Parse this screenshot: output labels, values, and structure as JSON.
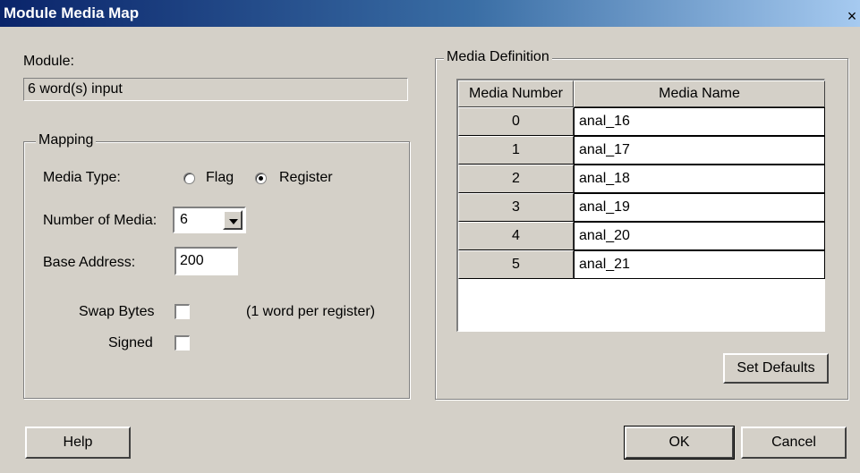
{
  "window": {
    "title": "Module Media Map",
    "close_glyph": "×"
  },
  "module": {
    "label": "Module:",
    "value": "6 word(s) input"
  },
  "mapping": {
    "group_label": "Mapping",
    "media_type_label": "Media Type:",
    "media_type_options": [
      "Flag",
      "Register"
    ],
    "media_type_selected": "Register",
    "number_of_media_label": "Number of Media:",
    "number_of_media_value": "6",
    "base_address_label": "Base Address:",
    "base_address_value": "200",
    "swap_bytes_label": "Swap Bytes",
    "swap_bytes_checked": false,
    "swap_bytes_note": "(1 word per register)",
    "signed_label": "Signed",
    "signed_checked": false
  },
  "media_definition": {
    "group_label": "Media Definition",
    "columns": [
      "Media Number",
      "Media Name"
    ],
    "rows": [
      {
        "number": "0",
        "name": "anal_16"
      },
      {
        "number": "1",
        "name": "anal_17"
      },
      {
        "number": "2",
        "name": "anal_18"
      },
      {
        "number": "3",
        "name": "anal_19"
      },
      {
        "number": "4",
        "name": "anal_20"
      },
      {
        "number": "5",
        "name": "anal_21"
      }
    ],
    "set_defaults_label": "Set Defaults"
  },
  "buttons": {
    "help": "Help",
    "ok": "OK",
    "cancel": "Cancel"
  }
}
